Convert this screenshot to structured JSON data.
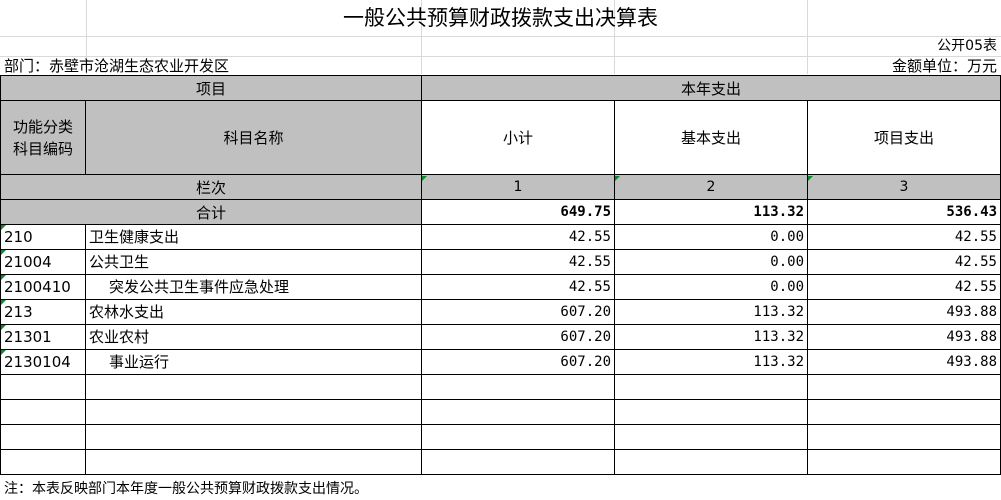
{
  "title": "一般公共预算财政拨款支出决算表",
  "form_code": "公开05表",
  "department": "部门：赤壁市沧湖生态农业开发区",
  "unit": "金额单位：万元",
  "headers": {
    "item": "项目",
    "year_expense": "本年支出",
    "func_code_line1": "功能分类",
    "func_code_line2": "科目编码",
    "subject_name": "科目名称",
    "subtotal": "小计",
    "basic": "基本支出",
    "project": "项目支出",
    "col_index": "栏次",
    "col1": "1",
    "col2": "2",
    "col3": "3",
    "total_label": "合计"
  },
  "totals": {
    "subtotal": "649.75",
    "basic": "113.32",
    "project": "536.43"
  },
  "rows": [
    {
      "code": "210",
      "name": "卫生健康支出",
      "subtotal": "42.55",
      "basic": "0.00",
      "project": "42.55"
    },
    {
      "code": "21004",
      "name": "公共卫生",
      "subtotal": "42.55",
      "basic": "0.00",
      "project": "42.55"
    },
    {
      "code": "2100410",
      "name": "突发公共卫生事件应急处理",
      "subtotal": "42.55",
      "basic": "0.00",
      "project": "42.55"
    },
    {
      "code": "213",
      "name": "农林水支出",
      "subtotal": "607.20",
      "basic": "113.32",
      "project": "493.88"
    },
    {
      "code": "21301",
      "name": "农业农村",
      "subtotal": "607.20",
      "basic": "113.32",
      "project": "493.88"
    },
    {
      "code": "2130104",
      "name": "事业运行",
      "subtotal": "607.20",
      "basic": "113.32",
      "project": "493.88"
    }
  ],
  "note": "注：本表反映部门本年度一般公共预算财政拨款支出情况。"
}
